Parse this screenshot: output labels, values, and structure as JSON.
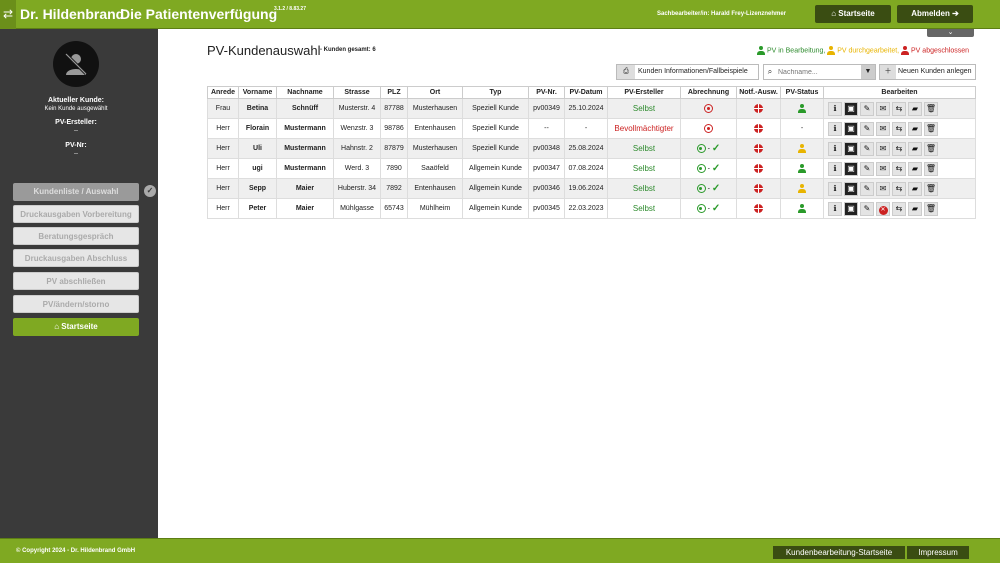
{
  "header": {
    "brand": "Dr. Hildenbrand",
    "title": "Die Patientenverfügung",
    "version": "3.1.2 / 8.83.27",
    "agent": "Sachbearbeiter/in: Harald Frey-Lizenznehmer",
    "home_label": "Startseite",
    "logout_label": "Abmelden"
  },
  "sidebar": {
    "current_customer_label": "Aktueller Kunde:",
    "current_customer_value": "Kein Kunde ausgewählt",
    "creator_label": "PV-Ersteller:",
    "creator_value": "--",
    "pvnr_label": "PV-Nr:",
    "pvnr_value": "--",
    "items": [
      {
        "label": "Kundenliste / Auswahl"
      },
      {
        "label": "Druckausgaben Vorbereitung"
      },
      {
        "label": "Beratungsgespräch"
      },
      {
        "label": "Druckausgaben Abschluss"
      },
      {
        "label": "PV abschließen"
      },
      {
        "label": "PV/ändern/storno"
      },
      {
        "label": "Startseite"
      }
    ]
  },
  "main": {
    "title": "PV-Kundenauswahl",
    "total": "- Kunden gesamt: 6",
    "legend": {
      "in_progress": "PV in Bearbeitung,",
      "reviewed": "PV durchgearbeitet,",
      "closed": "PV abgeschlossen"
    },
    "info_button": "Kunden Informationen/Fallbeispiele",
    "search_placeholder": "Nachname...",
    "new_customer_button": "Neuen Kunden anlegen",
    "columns": [
      "Anrede",
      "Vorname",
      "Nachname",
      "Strasse",
      "PLZ",
      "Ort",
      "Typ",
      "PV-Nr.",
      "PV-Datum",
      "PV-Ersteller",
      "Abrechnung",
      "Notf.-Ausw.",
      "PV-Status",
      "Bearbeiten"
    ],
    "rows": [
      {
        "anrede": "Frau",
        "vorname": "Betina",
        "nachname": "Schnüff",
        "strasse": "Musterstr. 4",
        "plz": "87788",
        "ort": "Musterhausen",
        "typ": "Speziell Kunde",
        "pvnr": "pv00349",
        "datum": "25.10.2024",
        "ersteller": "Selbst",
        "status": "green",
        "billed": false
      },
      {
        "anrede": "Herr",
        "vorname": "Florain",
        "nachname": "Mustermann",
        "strasse": "Wenzstr. 3",
        "plz": "98786",
        "ort": "Entenhausen",
        "typ": "Speziell Kunde",
        "pvnr": "--",
        "datum": "-",
        "ersteller": "Bevollmächtigter",
        "status": "none",
        "billed": false
      },
      {
        "anrede": "Herr",
        "vorname": "Uli",
        "nachname": "Mustermann",
        "strasse": "Hahnstr. 2",
        "plz": "87879",
        "ort": "Musterhausen",
        "typ": "Speziell Kunde",
        "pvnr": "pv00348",
        "datum": "25.08.2024",
        "ersteller": "Selbst",
        "status": "yellow",
        "billed": true
      },
      {
        "anrede": "Herr",
        "vorname": "ugi",
        "nachname": "Mustermann",
        "strasse": "Werd. 3",
        "plz": "7890",
        "ort": "Saaöfeld",
        "typ": "Allgemein Kunde",
        "pvnr": "pv00347",
        "datum": "07.08.2024",
        "ersteller": "Selbst",
        "status": "green",
        "billed": true
      },
      {
        "anrede": "Herr",
        "vorname": "Sepp",
        "nachname": "Maier",
        "strasse": "Huberstr. 34",
        "plz": "7892",
        "ort": "Entenhausen",
        "typ": "Allgemein Kunde",
        "pvnr": "pv00346",
        "datum": "19.06.2024",
        "ersteller": "Selbst",
        "status": "yellow",
        "billed": true
      },
      {
        "anrede": "Herr",
        "vorname": "Peter",
        "nachname": "Maier",
        "strasse": "Mühlgasse",
        "plz": "65743",
        "ort": "Mühlheim",
        "typ": "Allgemein Kunde",
        "pvnr": "pv00345",
        "datum": "22.03.2023",
        "ersteller": "Selbst",
        "status": "green",
        "billed": true
      }
    ],
    "status_dash": "-"
  },
  "footer": {
    "copyright": "© Copyright 2024 - Dr. Hildenbrand GmbH",
    "kb_button": "Kundenbearbeitung-Startseite",
    "imprint_button": "Impressum"
  }
}
